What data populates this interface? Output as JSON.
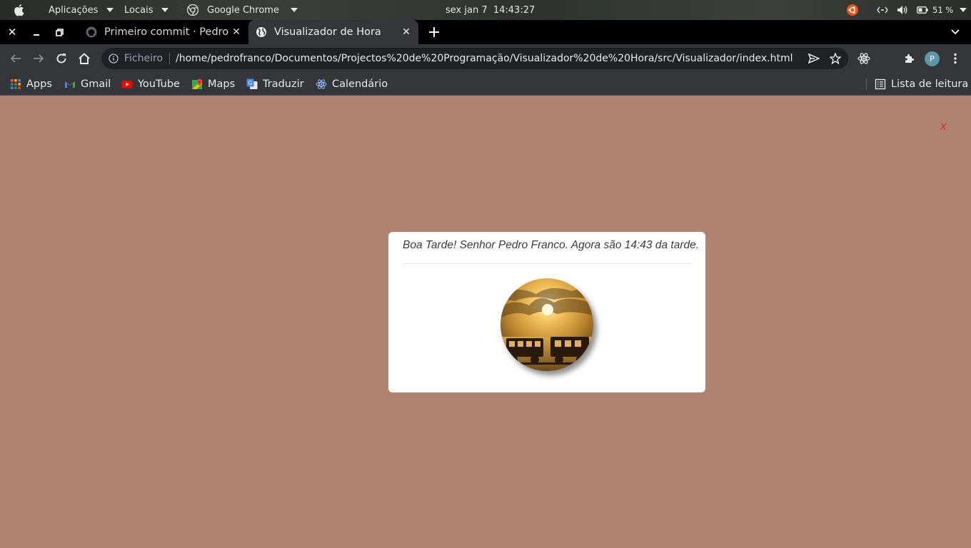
{
  "topbar": {
    "applications_label": "Aplicações",
    "places_label": "Locais",
    "app_label": "Google Chrome",
    "clock": "sex jan 7  14:43:27",
    "battery": "51 %"
  },
  "tabs": [
    {
      "title": "Primeiro commit · PedroFr",
      "active": false
    },
    {
      "title": "Visualizador de Hora",
      "active": true
    }
  ],
  "omnibox": {
    "scheme_label": "Ficheiro",
    "url": "/home/pedrofranco/Documentos/Projectos%20de%20Programação/Visualizador%20de%20Hora/src/Visualizador/index.html"
  },
  "profile": {
    "initial": "P"
  },
  "bookmarks": [
    {
      "label": "Apps",
      "icon": "apps-grid-icon"
    },
    {
      "label": "Gmail",
      "icon": "gmail-icon"
    },
    {
      "label": "YouTube",
      "icon": "youtube-icon"
    },
    {
      "label": "Maps",
      "icon": "maps-icon"
    },
    {
      "label": "Traduzir",
      "icon": "translate-icon"
    },
    {
      "label": "Calendário",
      "icon": "react-icon"
    }
  ],
  "reading_list_label": "Lista de leitura",
  "page": {
    "close_label": "x",
    "greeting": "Boa Tarde! Senhor Pedro Franco. Agora são 14:43 da tarde."
  },
  "colors": {
    "page_background": "#af8370",
    "card_background": "#ffffff",
    "close_color": "#d9322a",
    "toolbar": "#35363a"
  }
}
